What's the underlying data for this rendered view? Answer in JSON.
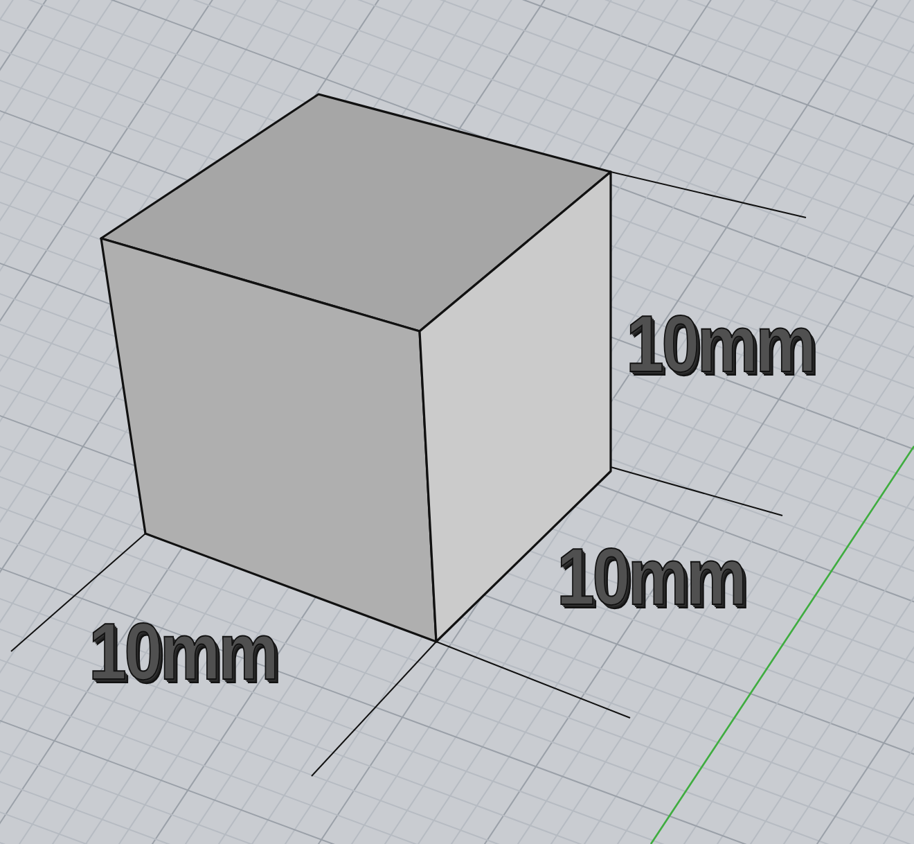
{
  "viewport": {
    "labels": [
      {
        "text": "10mm"
      },
      {
        "text": "10mm"
      },
      {
        "text": "10mm"
      }
    ]
  }
}
